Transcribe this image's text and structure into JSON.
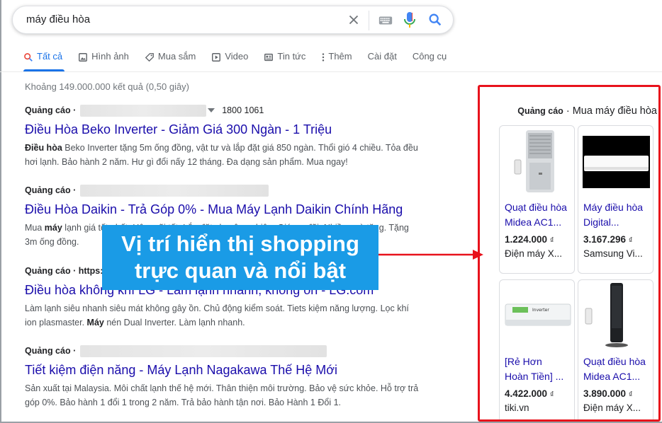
{
  "search": {
    "query": "máy điều hòa"
  },
  "tabs": [
    {
      "label": "Tất cả",
      "icon": "search-icon"
    },
    {
      "label": "Hình ảnh",
      "icon": "image-icon"
    },
    {
      "label": "Mua sắm",
      "icon": "tag-icon"
    },
    {
      "label": "Video",
      "icon": "play-icon"
    },
    {
      "label": "Tin tức",
      "icon": "news-icon"
    },
    {
      "label": "Thêm",
      "icon": "more-icon"
    },
    {
      "label": "Cài đặt",
      "icon": ""
    },
    {
      "label": "Công cụ",
      "icon": ""
    }
  ],
  "stats": "Khoảng 149.000.000 kết quả (0,50 giây)",
  "ads": [
    {
      "label": "Quảng cáo ·",
      "phone": "1800 1061",
      "title": "Điều Hòa Beko Inverter - Giảm Giá 300 Ngàn - 1 Triệu",
      "desc_bold": "Điều hòa",
      "desc_rest": " Beko Inverter tặng 5m ống đồng, vật tư và lắp đặt giá 850 ngàn. Thổi gió 4 chiều. Tỏa đều hơi lạnh. Bảo hành 2 năm. Hư gì đổi nấy 12 tháng. Đa dạng sản phẩm. Mua ngay!"
    },
    {
      "label": "Quảng cáo ·",
      "title": "Điều Hòa Daikin - Trả Góp 0% - Mua Máy Lạnh Daikin Chính Hãng",
      "desc_pre": "Mua ",
      "desc_bold": "máy",
      "desc_rest": " lạnh giá tốt nhất. Hậu mãi tốt. Lắp đặt chuyên nghiệp. Giá ưu đãi. Nhiều quà tặng. Tặng 3m ống đồng."
    },
    {
      "label": "Quảng cáo · https:",
      "title": "Điều hòa không khí LG - Làm lạnh nhanh, không ồn - LG.com",
      "desc_1": "Làm lạnh siêu nhanh siêu mát không gây ồn. Chủ động kiểm soát. Tiets kiệm năng lượng. Lọc khí ion plasmaster. ",
      "desc_bold": "Máy",
      "desc_rest": " nén Dual Inverter. Làm lạnh nhanh."
    },
    {
      "label": "Quảng cáo ·",
      "title": "Tiết kiệm điện năng - Máy Lạnh Nagakawa Thế Hệ Mới",
      "desc": "Sản xuất tại Malaysia. Môi chất lạnh thế hệ mới. Thân thiện môi trường. Bảo vệ sức khỏe. Hỗ trợ trả góp 0%. Bảo hành 1 đổi 1 trong 2 năm. Trả bảo hành tận nơi. Bảo Hành 1 Đổi 1."
    }
  ],
  "callout": {
    "line1": "Vị trí hiển thị shopping",
    "line2": "trực quan và nổi bật",
    "color": "#1a9be6"
  },
  "shopping": {
    "label": "Quảng cáo",
    "heading": " · Mua máy điều hòa",
    "border_color": "#e8121c",
    "products": [
      {
        "title1": "Quạt điều hòa",
        "title2": "Midea AC1...",
        "price": "1.224.000",
        "currency": "₫",
        "store": "Điện máy X..."
      },
      {
        "title1": "Máy điều hòa",
        "title2": "Digital...",
        "price": "3.167.296",
        "currency": "₫",
        "store": "Samsung Vi..."
      },
      {
        "title1": "[Rẻ Hơn",
        "title2": "Hoàn Tiền] ...",
        "price": "4.422.000",
        "currency": "₫",
        "store": "tiki.vn"
      },
      {
        "title1": "Quạt điều hòa",
        "title2": "Midea AC1...",
        "price": "3.890.000",
        "currency": "₫",
        "store": "Điện máy X..."
      }
    ]
  }
}
